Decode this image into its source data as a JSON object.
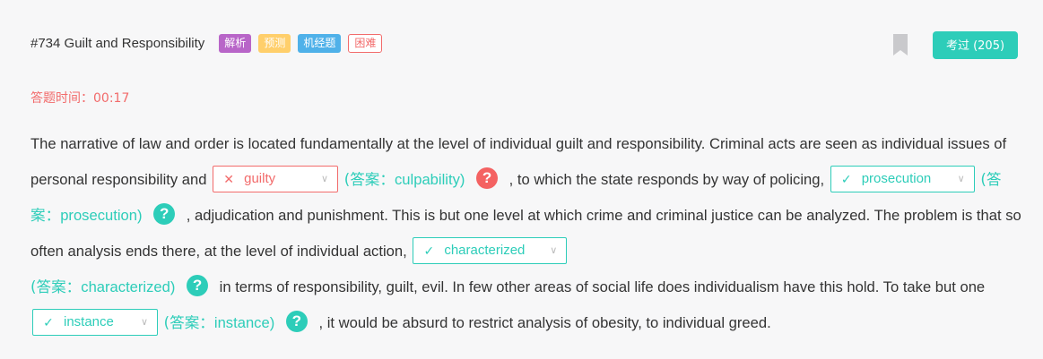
{
  "header": {
    "title": "#734 Guilt and Responsibility",
    "tags": [
      "解析",
      "预测",
      "机经题",
      "困难"
    ],
    "pass_button": "考过 (205)"
  },
  "timer": {
    "label": "答题时间：00:17"
  },
  "passage": {
    "t1": "The narrative of law and order is located fundamentally at the level of individual guilt and responsibility. Criminal acts are seen as individual issues of personal responsibility and",
    "t2": ", to which the state responds by way of policing,",
    "t3": ", adjudication and punishment. This is but one level at which crime and criminal justice can be analyzed. The problem is that so often analysis ends there, at the level of individual action,",
    "t4": "in terms of responsibility, guilt, evil. In few other areas of social life does individualism have this hold. To take but one",
    "t5": ", it would be absurd to restrict analysis of obesity, to individual greed.",
    "answer_prefix": "(答案：",
    "answer_suffix": ")",
    "blanks": [
      {
        "value": "guilty",
        "answer": "culpability",
        "correct": false,
        "mark": "✕"
      },
      {
        "value": "prosecution",
        "answer": "prosecution",
        "correct": true,
        "mark": "✓"
      },
      {
        "value": "characterized",
        "answer": "characterized",
        "correct": true,
        "mark": "✓"
      },
      {
        "value": "instance",
        "answer": "instance",
        "correct": true,
        "mark": "✓"
      }
    ],
    "help_glyph": "?",
    "chevron": "∨"
  },
  "colors": {
    "accent": "#2dcdb9",
    "error": "#f26b6b",
    "tag_purple": "#b865c8",
    "tag_yellow": "#ffcf6b",
    "tag_blue": "#4fb1e9"
  }
}
